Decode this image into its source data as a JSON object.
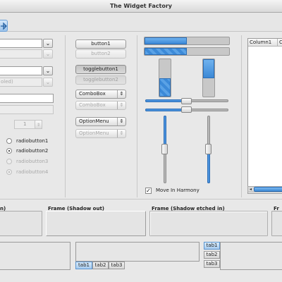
{
  "window": {
    "title": "The Widget Factory"
  },
  "col1": {
    "combo_entry_disabled_text": "oled)",
    "spin_value": "1",
    "radios": [
      {
        "label": "radiobutton1",
        "active": false,
        "sensitive": true
      },
      {
        "label": "radiobutton2",
        "active": true,
        "sensitive": true
      },
      {
        "label": "radiobutton3",
        "active": false,
        "sensitive": false
      },
      {
        "label": "radiobutton4",
        "active": true,
        "sensitive": false
      }
    ]
  },
  "col2": {
    "button1": "button1",
    "button2": "button2",
    "togglebutton1": "togglebutton1",
    "togglebutton2": "togglebutton2",
    "combobox1": "ComboBox",
    "combobox2": "ComboBox",
    "optionmenu1": "OptionMenu",
    "optionmenu2": "OptionMenu"
  },
  "col3": {
    "progress_h1": 0.5,
    "progress_h2": 0.5,
    "progress_v1": 0.5,
    "progress_v2": 0.5,
    "hscale1": 0.5,
    "hscale2": 0.5,
    "vscale1": 0.5,
    "vscale2": 0.5,
    "harmony_label": "Move In Harmony",
    "harmony_checked": true
  },
  "tree": {
    "columns": [
      "Column1",
      "Co"
    ]
  },
  "frames": [
    {
      "label": "n)"
    },
    {
      "label": "Frame (Shadow out)"
    },
    {
      "label": "Frame (Shadow etched in)"
    },
    {
      "label": "Fr"
    }
  ],
  "notebook_bottom": {
    "tabs": [
      "tab1",
      "tab2",
      "tab3"
    ]
  },
  "notebook_side": {
    "tabs": [
      "tab1",
      "tab2",
      "tab3"
    ]
  },
  "icons": {
    "toolbar_pin": "pin-icon",
    "dropdown": "chevron-down-icon",
    "updown": "updown-icon"
  },
  "colors": {
    "accent": "#4a92dd"
  }
}
